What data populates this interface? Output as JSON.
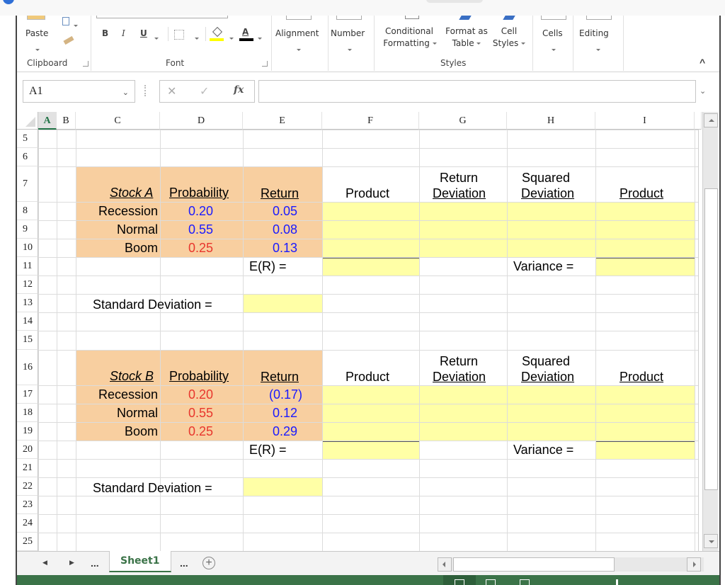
{
  "ribbon": {
    "clipboard": {
      "paste_label": "Paste",
      "group_label": "Clipboard"
    },
    "font": {
      "group_label": "Font",
      "bold": "B",
      "italic": "I",
      "underline": "U",
      "font_color_glyph": "A",
      "highlight_color": "#ffff00",
      "font_color": "#000000"
    },
    "alignment_label": "Alignment",
    "number_label": "Number",
    "styles": {
      "conditional_formatting": [
        "Conditional",
        "Formatting"
      ],
      "format_as_table": [
        "Format as",
        "Table"
      ],
      "cell_styles": [
        "Cell",
        "Styles"
      ],
      "group_label": "Styles"
    },
    "cells_label": "Cells",
    "editing_label": "Editing",
    "collapse_icon": "^"
  },
  "formula_bar": {
    "name_box": "A1",
    "cancel_icon": "✕",
    "enter_icon": "✓",
    "fx_label": "fx",
    "formula_value": ""
  },
  "columns": [
    "A",
    "B",
    "C",
    "D",
    "E",
    "F",
    "G",
    "H",
    "I"
  ],
  "rows": [
    "5",
    "6",
    "7",
    "8",
    "9",
    "10",
    "11",
    "12",
    "13",
    "14",
    "15",
    "16",
    "17",
    "18",
    "19",
    "20",
    "21",
    "22",
    "23",
    "24",
    "25"
  ],
  "colors": {
    "input_fill": "#f8cfa0",
    "answer_fill": "#ffffa6",
    "blue_text": "#1a1aff",
    "red_text": "#e8362d",
    "accent_green": "#3b7348"
  },
  "stock_a": {
    "title": "Stock A",
    "prob_header": "Probability",
    "return_header": "Return",
    "product_header": "Product",
    "return_dev_header": [
      "Return",
      "Deviation"
    ],
    "sq_dev_header": [
      "Squared",
      "Deviation"
    ],
    "product2_header": "Product",
    "states": [
      {
        "name": "Recession",
        "prob": "0.20",
        "prob_color": "blue",
        "ret": "0.05"
      },
      {
        "name": "Normal",
        "prob": "0.55",
        "prob_color": "blue",
        "ret": "0.08"
      },
      {
        "name": "Boom",
        "prob": "0.25",
        "prob_color": "red",
        "ret": "0.13"
      }
    ],
    "er_label": "E(R) =",
    "variance_label": "Variance =",
    "std_label": "Standard Deviation ="
  },
  "stock_b": {
    "title": "Stock B",
    "prob_header": "Probability",
    "return_header": "Return",
    "product_header": "Product",
    "return_dev_header": [
      "Return",
      "Deviation"
    ],
    "sq_dev_header": [
      "Squared",
      "Deviation"
    ],
    "product2_header": "Product",
    "states": [
      {
        "name": "Recession",
        "prob": "0.20",
        "prob_color": "red",
        "ret": "(0.17)"
      },
      {
        "name": "Normal",
        "prob": "0.55",
        "prob_color": "red",
        "ret": "0.12"
      },
      {
        "name": "Boom",
        "prob": "0.25",
        "prob_color": "red",
        "ret": "0.29"
      }
    ],
    "er_label": "E(R) =",
    "variance_label": "Variance =",
    "std_label": "Standard Deviation ="
  },
  "sheet_tabs": {
    "prev_icon": "◀",
    "next_icon": "▶",
    "ellipsis_left": "...",
    "active_tab": "Sheet1",
    "ellipsis_right": "...",
    "add_icon": "+"
  }
}
